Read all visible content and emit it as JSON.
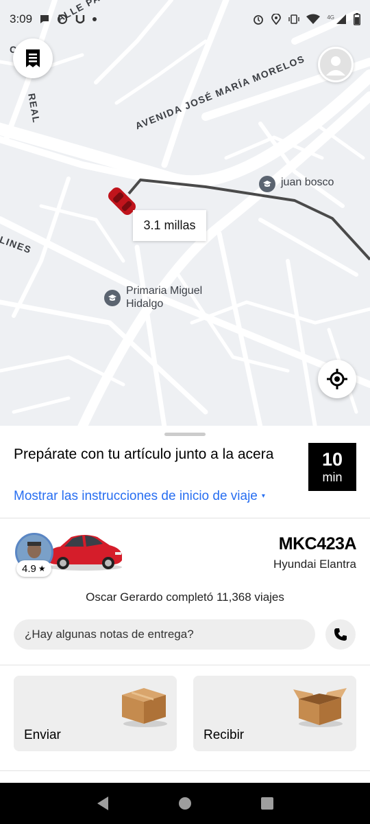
{
  "status_bar": {
    "time": "3:09",
    "left_icons": [
      "chat-icon",
      "whatsapp-icon",
      "uber-icon",
      "dot-icon"
    ],
    "right_icons": [
      "alarm-icon",
      "location-icon",
      "vibrate-icon",
      "wifi-icon",
      "signal-icon",
      "battery-icon"
    ],
    "network": "4G"
  },
  "map": {
    "streets": {
      "paso_real_top": "ALLE PASO RE",
      "real": "REAL",
      "morelos": "AVENIDA JOSÉ MARÍA MORELOS",
      "lines": "LINES",
      "real_prefix": "C"
    },
    "pois": {
      "juan_bosco": "juan bosco",
      "primaria_line1": "Primaria Miguel",
      "primaria_line2": "Hidalgo"
    },
    "distance_label": "3.1 millas",
    "route_color": "#4a4a4a",
    "car_color": "#c0141c"
  },
  "trip": {
    "headline": "Prepárate con tu artículo junto a la acera",
    "eta_value": "10",
    "eta_unit": "min",
    "instructions_link": "Mostrar las instrucciones de inicio de viaje",
    "accent_color": "#276ef1"
  },
  "driver": {
    "rating": "4.9",
    "plate": "MKC423A",
    "car_model": "Hyundai Elantra",
    "trips_text": "Oscar Gerardo completó 11,368 viajes",
    "notes_placeholder": "¿Hay algunas notas de entrega?"
  },
  "actions": {
    "send_label": "Enviar",
    "receive_label": "Recibir"
  }
}
